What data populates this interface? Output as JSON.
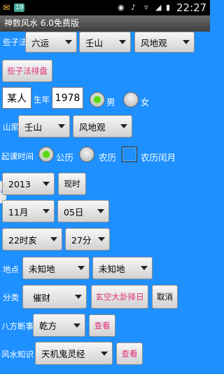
{
  "status": {
    "time": "22:27",
    "notif": "19"
  },
  "title": "神数风水 6.0免费版",
  "xiezifa": {
    "label": "些子法",
    "yun": "六运",
    "shan": "壬山",
    "di": "风地观",
    "pan_btn": "些子法排盘"
  },
  "person": {
    "name": "某人",
    "birth_label": "生年",
    "year": "1978",
    "male": "男",
    "female": "女",
    "gender": "男"
  },
  "shanjia": {
    "label": "山家",
    "shan": "壬山",
    "gua": "风地观"
  },
  "qike": {
    "label": "起课时间",
    "gongli": "公历",
    "nongli": "农历",
    "runyue": "农历闰月",
    "selected": "公历",
    "runyue_checked": false
  },
  "date": {
    "year": "2013",
    "now_btn": "现时",
    "month": "11月",
    "day": "05日",
    "hour": "22时亥",
    "minute": "27分"
  },
  "place": {
    "label": "地点",
    "a": "未知地",
    "b": "未知地"
  },
  "category": {
    "label": "分类",
    "value": "催财",
    "zeri_btn": "玄空大卦择日",
    "cancel_btn": "取消"
  },
  "bafang": {
    "label": "八方断事",
    "value": "乾方",
    "view_btn": "查看"
  },
  "knowledge": {
    "label": "风水知识",
    "value": "天机鬼灵经",
    "view_btn": "查看"
  }
}
